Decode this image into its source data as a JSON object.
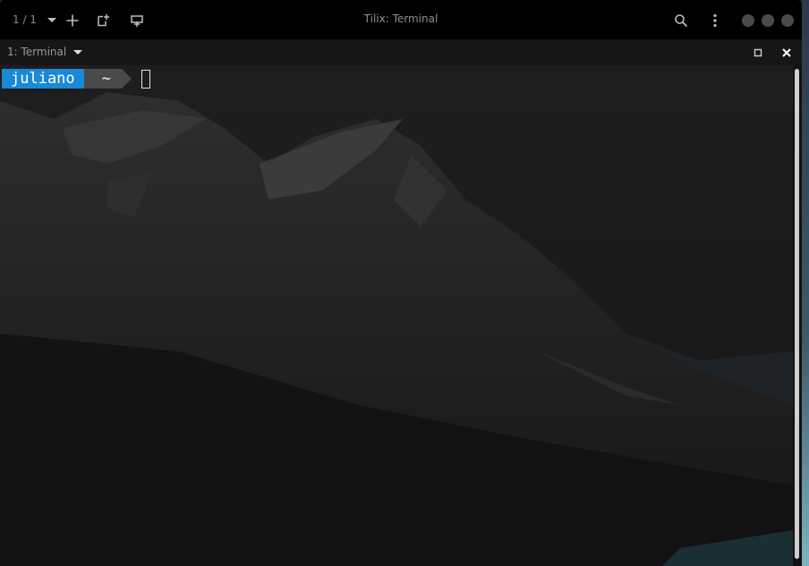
{
  "header": {
    "session_counter": "1 / 1",
    "title": "Tilix: Terminal",
    "icons": {
      "add": "plus-icon",
      "add_right": "add-terminal-right-icon",
      "add_down": "add-terminal-down-icon",
      "search": "search-icon",
      "menu": "vertical-dots-menu-icon"
    }
  },
  "terminal": {
    "title": "1: Terminal",
    "maximize_icon": "maximize-icon",
    "close_icon": "close-icon"
  },
  "prompt": {
    "user": "juliano",
    "dir": "~"
  },
  "colors": {
    "accent": "#1a89d6",
    "dir_segment": "#4a4a4a"
  }
}
